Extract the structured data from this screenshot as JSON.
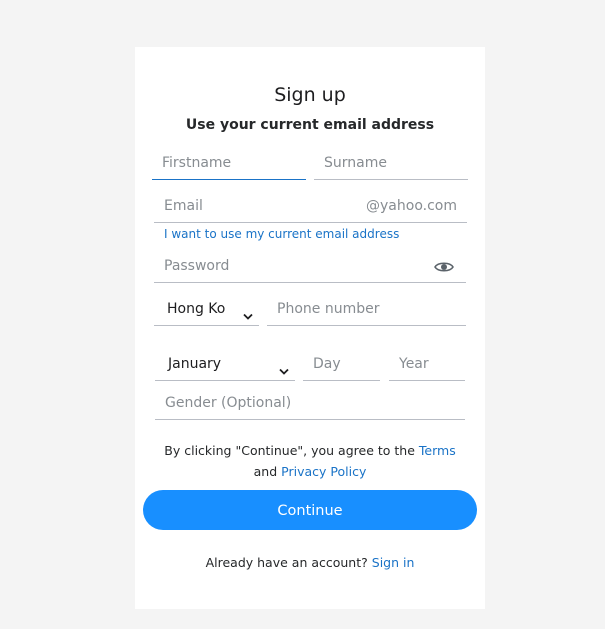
{
  "form": {
    "title": "Sign up",
    "subtitle": "Use your current email address",
    "firstname_placeholder": "Firstname",
    "surname_placeholder": "Surname",
    "email_placeholder": "Email",
    "email_suffix": "@yahoo.com",
    "use_current_email_link": "I want to use my current email address",
    "password_placeholder": "Password",
    "country_code_value": "Hong Ko",
    "phone_placeholder": "Phone number",
    "month_value": "January",
    "day_placeholder": "Day",
    "year_placeholder": "Year",
    "gender_placeholder": "Gender (Optional)",
    "terms_prefix": "By clicking \"Continue\", you agree to the",
    "terms_link": "Terms",
    "terms_and": "and",
    "privacy_link": "Privacy Policy",
    "continue_label": "Continue",
    "have_account_text": "Already have an account?",
    "sign_in_link": "Sign in"
  },
  "colors": {
    "accent": "#188fff",
    "link": "#1a73c7",
    "background": "#f4f4f4",
    "card": "#ffffff"
  },
  "icons": {
    "password_toggle": "eye-icon",
    "select_arrow": "chevron-down-icon"
  }
}
